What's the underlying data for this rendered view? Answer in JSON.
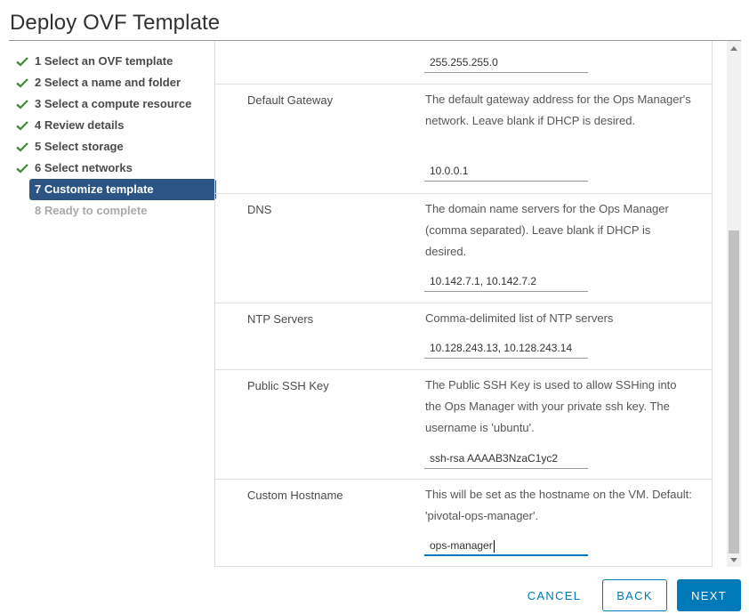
{
  "dialog": {
    "title": "Deploy OVF Template"
  },
  "steps": [
    {
      "label": "1 Select an OVF template",
      "state": "done"
    },
    {
      "label": "2 Select a name and folder",
      "state": "done"
    },
    {
      "label": "3 Select a compute resource",
      "state": "done"
    },
    {
      "label": "4 Review details",
      "state": "done"
    },
    {
      "label": "5 Select storage",
      "state": "done"
    },
    {
      "label": "6 Select networks",
      "state": "done"
    },
    {
      "label": "7 Customize template",
      "state": "active"
    },
    {
      "label": "8 Ready to complete",
      "state": "disabled"
    }
  ],
  "fields": {
    "netmask": {
      "value": "255.255.255.0"
    },
    "gateway": {
      "label": "Default Gateway",
      "description": "The default gateway address for the Ops Manager's network. Leave blank if DHCP is desired.",
      "value": "10.0.0.1"
    },
    "dns": {
      "label": "DNS",
      "description": "The domain name servers for the Ops Manager (comma separated). Leave blank if DHCP is desired.",
      "value": "10.142.7.1, 10.142.7.2"
    },
    "ntp": {
      "label": "NTP Servers",
      "description": "Comma-delimited list of NTP servers",
      "value": "10.128.243.13, 10.128.243.14"
    },
    "ssh": {
      "label": "Public SSH Key",
      "description": "The Public SSH Key is used to allow SSHing into the Ops Manager with your private ssh key. The username is 'ubuntu'.",
      "value": "ssh-rsa AAAAB3NzaC1yc2"
    },
    "hostname": {
      "label": "Custom Hostname",
      "description": "This will be set as the hostname on the VM. Default: 'pivotal-ops-manager'.",
      "value": "ops-manager"
    }
  },
  "buttons": {
    "cancel": "CANCEL",
    "back": "BACK",
    "next": "NEXT"
  },
  "colors": {
    "accent": "#0079b8",
    "active_step": "#2c5585",
    "check": "#3c8a2e"
  }
}
